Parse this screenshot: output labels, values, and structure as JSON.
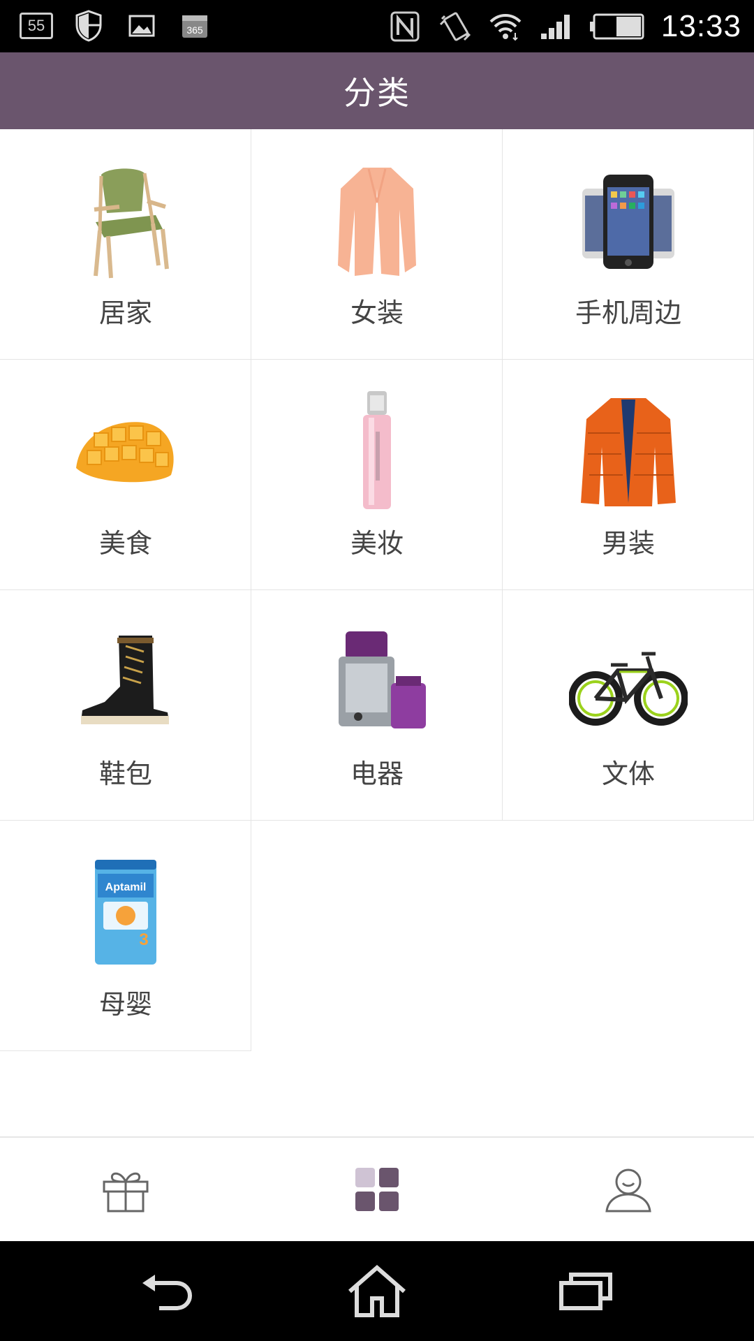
{
  "status_bar": {
    "time": "13:33",
    "battery": "55%",
    "notification_count": "55",
    "calendar_text": "365",
    "icons": [
      "notification-55-icon",
      "shield-icon",
      "image-icon",
      "calendar-365-icon",
      "nfc-icon",
      "vibrate-icon",
      "wifi-icon",
      "signal-icon",
      "battery-icon"
    ]
  },
  "header": {
    "title": "分类"
  },
  "categories": [
    {
      "label": "居家",
      "icon": "chair-icon"
    },
    {
      "label": "女装",
      "icon": "cardigan-icon"
    },
    {
      "label": "手机周边",
      "icon": "phones-icon"
    },
    {
      "label": "美食",
      "icon": "mango-icon"
    },
    {
      "label": "美妆",
      "icon": "lipgloss-icon"
    },
    {
      "label": "男装",
      "icon": "jacket-icon"
    },
    {
      "label": "鞋包",
      "icon": "boot-icon"
    },
    {
      "label": "电器",
      "icon": "juicer-icon"
    },
    {
      "label": "文体",
      "icon": "bicycle-icon"
    },
    {
      "label": "母婴",
      "icon": "formula-can-icon",
      "brand_text": "Aptamil"
    }
  ],
  "bottom_nav": {
    "items": [
      {
        "icon": "gift-icon",
        "active": false
      },
      {
        "icon": "category-grid-icon",
        "active": true
      },
      {
        "icon": "profile-icon",
        "active": false
      }
    ]
  },
  "colors": {
    "header": "#6a556d",
    "accent": "#6a556d",
    "divider": "#e4e4e4"
  },
  "system_nav": {
    "icons": [
      "back-icon",
      "home-icon",
      "recents-icon"
    ]
  }
}
